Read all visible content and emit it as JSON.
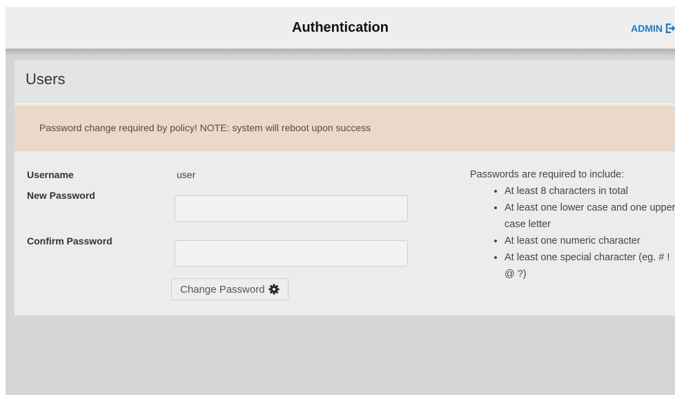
{
  "header": {
    "title": "Authentication",
    "user_label": "ADMIN",
    "user_icon": "logout-icon"
  },
  "panel": {
    "title": "Users",
    "alert": "Password change required by policy! NOTE: system will reboot upon success"
  },
  "form": {
    "username_label": "Username",
    "username_value": "user",
    "new_password_label": "New Password",
    "new_password_value": "",
    "confirm_password_label": "Confirm Password",
    "confirm_password_value": "",
    "submit_label": "Change Password",
    "submit_icon": "gear-icon"
  },
  "requirements": {
    "heading": "Passwords are required to include:",
    "items": [
      "At least 8 characters in total",
      "At least one lower case and one upper case letter",
      "At least one numeric character",
      "At least one special character (eg. # ! @ ?)"
    ]
  },
  "colors": {
    "link": "#1f78c8",
    "alert_background": "#ead9c8",
    "screen_background": "#d4d5d7"
  }
}
